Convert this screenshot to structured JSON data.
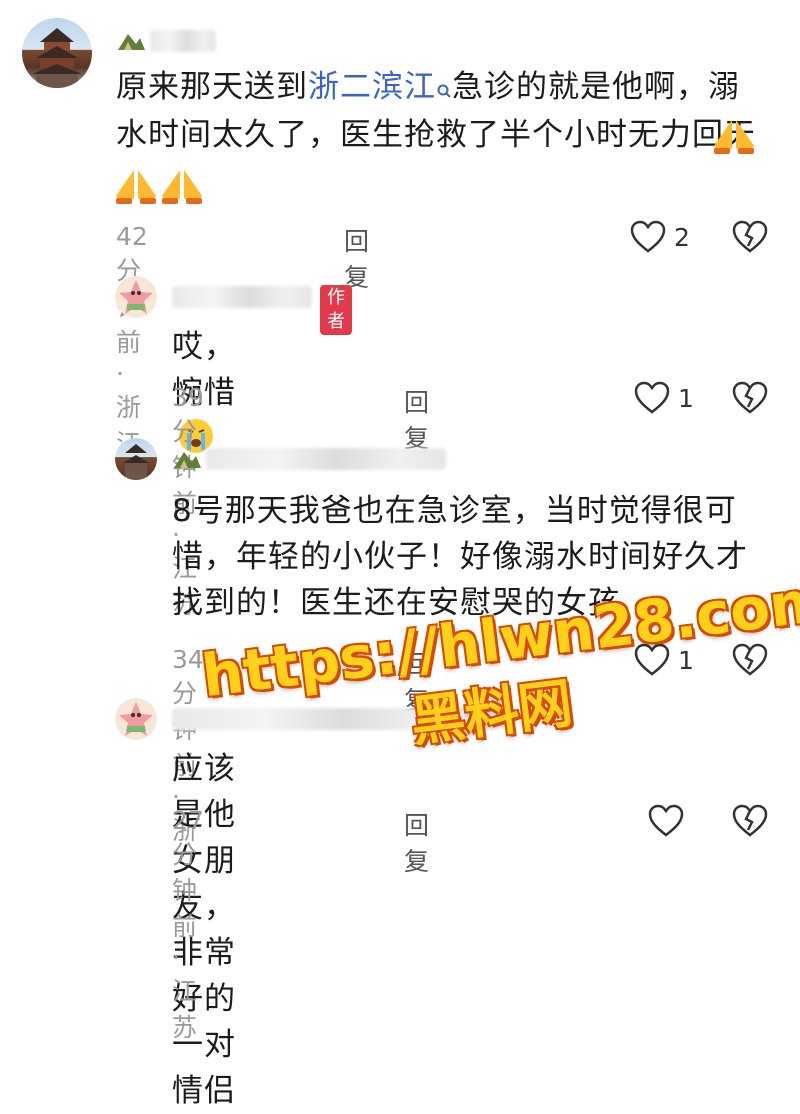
{
  "comments": [
    {
      "text_parts": [
        "原来那天送到",
        "浙二滨江",
        "急诊的就是他啊，溺水时间太久了，医生抢救了半个小时无力回天"
      ],
      "meta": "42分钟前 · 浙江",
      "reply": "回复",
      "likes": "2"
    },
    {
      "badge": "作者",
      "text": "哎，惋惜",
      "meta": "39分钟前 · 江苏",
      "reply": "回复",
      "likes": "1"
    },
    {
      "text_line1": "8号那天我爸也在急诊室，当时觉得很可",
      "text_line2": "惜，年轻的小伙子！好像溺水时间好久才",
      "text_line3": "找到的！医生还在安慰哭的女孩",
      "meta": "34分钟前 · 浙",
      "reply": "回复",
      "likes": "1"
    },
    {
      "text": "应该是他女朋友，非常好的一对情侣",
      "meta": "27分钟前 · 江苏",
      "reply": "回复",
      "likes": ""
    }
  ],
  "icons": {
    "like": "heart-outline-icon",
    "dislike": "broken-heart-icon",
    "search": "search-icon",
    "pray": "pray-emoji-icon",
    "cry": "crying-emoji-icon"
  },
  "watermark": {
    "line1": "https://hlwn28.com",
    "line2": "黑料网"
  },
  "colors": {
    "link": "#3b64c8",
    "badge": "#e23a48",
    "meta": "#9a9a9a",
    "watermark_fill": "#ffd11a",
    "watermark_stroke": "#d94a00"
  }
}
